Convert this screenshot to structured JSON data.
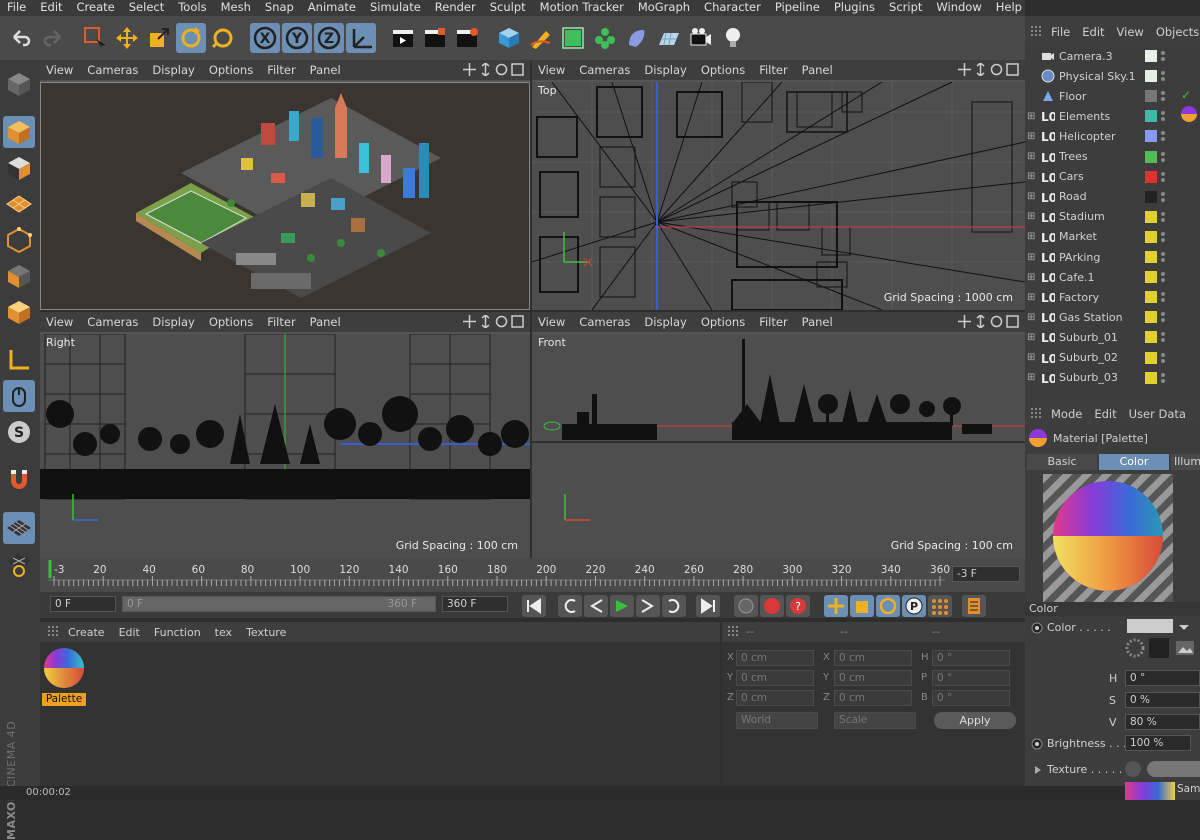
{
  "menu": [
    "File",
    "Edit",
    "Create",
    "Select",
    "Tools",
    "Mesh",
    "Snap",
    "Animate",
    "Simulate",
    "Render",
    "Sculpt",
    "Motion Tracker",
    "MoGraph",
    "Character",
    "Pipeline",
    "Plugins",
    "Script",
    "Window",
    "Help"
  ],
  "toolbar": {
    "axis_x": "X",
    "axis_y": "Y",
    "axis_z": "Z"
  },
  "viewports": [
    {
      "menu": [
        "View",
        "Cameras",
        "Display",
        "Options",
        "Filter",
        "Panel"
      ],
      "label": "",
      "grid": ""
    },
    {
      "menu": [
        "View",
        "Cameras",
        "Display",
        "Options",
        "Filter",
        "Panel"
      ],
      "label": "Top",
      "grid": "Grid Spacing : 1000 cm"
    },
    {
      "menu": [
        "View",
        "Cameras",
        "Display",
        "Options",
        "Filter",
        "Panel"
      ],
      "label": "Right",
      "grid": "Grid Spacing : 100 cm"
    },
    {
      "menu": [
        "View",
        "Cameras",
        "Display",
        "Options",
        "Filter",
        "Panel"
      ],
      "label": "Front",
      "grid": "Grid Spacing : 100 cm"
    }
  ],
  "timeline": {
    "ticks": [
      "-3",
      "20",
      "40",
      "60",
      "80",
      "100",
      "120",
      "140",
      "160",
      "180",
      "200",
      "220",
      "240",
      "260",
      "280",
      "300",
      "320",
      "340",
      "360"
    ],
    "current_frame": "-3 F",
    "start_field": "0 F",
    "range_start": "0 F",
    "range_end": "360 F",
    "end_field": "360 F"
  },
  "material_manager": {
    "menu": [
      "Create",
      "Edit",
      "Function",
      "tex",
      "Texture"
    ],
    "materials": [
      {
        "name": "Palette"
      }
    ]
  },
  "coordinates": {
    "headers": [
      "--",
      "--",
      "--"
    ],
    "rows": [
      {
        "a": "X",
        "av": "0 cm",
        "b": "X",
        "bv": "0 cm",
        "c": "H",
        "cv": "0 °"
      },
      {
        "a": "Y",
        "av": "0 cm",
        "b": "Y",
        "bv": "0 cm",
        "c": "P",
        "cv": "0 °"
      },
      {
        "a": "Z",
        "av": "0 cm",
        "b": "Z",
        "bv": "0 cm",
        "c": "B",
        "cv": "0 °"
      }
    ],
    "mode": "World",
    "scale": "Scale",
    "apply": "Apply"
  },
  "object_manager": {
    "menu": [
      "File",
      "Edit",
      "View",
      "Objects"
    ],
    "objects": [
      {
        "name": "Camera.3",
        "icon": "camera",
        "color": "#e6f0e6"
      },
      {
        "name": "Physical Sky.1",
        "icon": "sky",
        "color": "#e6f0e6"
      },
      {
        "name": "Floor",
        "icon": "floor",
        "color": "#777777"
      },
      {
        "name": "Elements",
        "icon": "null",
        "color": "#3fb8a8"
      },
      {
        "name": "Helicopter",
        "icon": "null",
        "color": "#8899ee"
      },
      {
        "name": "Trees",
        "icon": "null",
        "color": "#55bb55"
      },
      {
        "name": "Cars",
        "icon": "null",
        "color": "#dd3333"
      },
      {
        "name": "Road",
        "icon": "null",
        "color": "#222222"
      },
      {
        "name": "Stadium",
        "icon": "null",
        "color": "#e0d030"
      },
      {
        "name": "Market",
        "icon": "null",
        "color": "#e0d030"
      },
      {
        "name": "PArking",
        "icon": "null",
        "color": "#e0d030"
      },
      {
        "name": "Cafe.1",
        "icon": "null",
        "color": "#e0d030"
      },
      {
        "name": "Factory",
        "icon": "null",
        "color": "#e0d030"
      },
      {
        "name": "Gas Station",
        "icon": "null",
        "color": "#e0d030"
      },
      {
        "name": "Suburb_01",
        "icon": "null",
        "color": "#e0d030"
      },
      {
        "name": "Suburb_02",
        "icon": "null",
        "color": "#e0d030"
      },
      {
        "name": "Suburb_03",
        "icon": "null",
        "color": "#e0d030"
      }
    ]
  },
  "attribute_manager": {
    "menu": [
      "Mode",
      "Edit",
      "User Data"
    ],
    "title": "Material [Palette]",
    "tabs": [
      "Basic",
      "Color",
      "Illumi"
    ],
    "section": "Color",
    "color_label": "Color . . . . .",
    "h_label": "H",
    "h_value": "0 °",
    "s_label": "S",
    "s_value": "0 %",
    "v_label": "V",
    "v_value": "80 %",
    "brightness_label": "Brightness . . .",
    "brightness_value": "100 %",
    "texture_label": "Texture . . . . .",
    "sample_label": "Sam"
  },
  "status": {
    "time": "00:00:02"
  },
  "brand": {
    "maxon": "MAXON",
    "product": "CINEMA 4D"
  }
}
